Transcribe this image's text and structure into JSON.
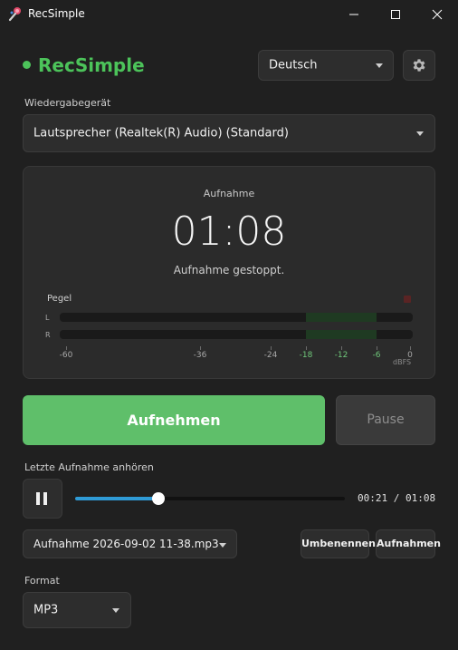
{
  "window": {
    "title": "RecSimple"
  },
  "header": {
    "brand": "RecSimple",
    "language": "Deutsch"
  },
  "playback_device": {
    "label": "Wiedergabegerät",
    "selected": "Lautsprecher (Realtek(R) Audio) (Standard)"
  },
  "recorder": {
    "label": "Aufnahme",
    "timer": "01:08",
    "status": "Aufnahme gestoppt.",
    "level": {
      "label": "Pegel",
      "left_channel": "L",
      "right_channel": "R",
      "left_level_dbfs": -18,
      "right_level_dbfs": -18,
      "ticks": [
        "-60",
        "-36",
        "-24",
        "-18",
        "-12",
        "-6",
        "0"
      ],
      "unit": "dBFS"
    }
  },
  "actions": {
    "record": "Aufnehmen",
    "pause": "Pause"
  },
  "last_recording": {
    "label": "Letzte Aufnahme anhören",
    "elapsed": "00:21",
    "total": "01:08",
    "progress": 0.31,
    "time_text": "00:21 / 01:08"
  },
  "file": {
    "selected": "Aufnahme 2026-09-02 11-38.mp3",
    "rename": "Umbenennen",
    "recordings": "Aufnahmen"
  },
  "format": {
    "label": "Format",
    "selected": "MP3"
  },
  "colors": {
    "accent": "#4cc35a",
    "record_button": "#5fbf6a",
    "slider": "#2f9bd6"
  },
  "icons": {
    "app": "microphone-logo-icon",
    "settings": "gear-icon",
    "pause": "pause-icon"
  }
}
